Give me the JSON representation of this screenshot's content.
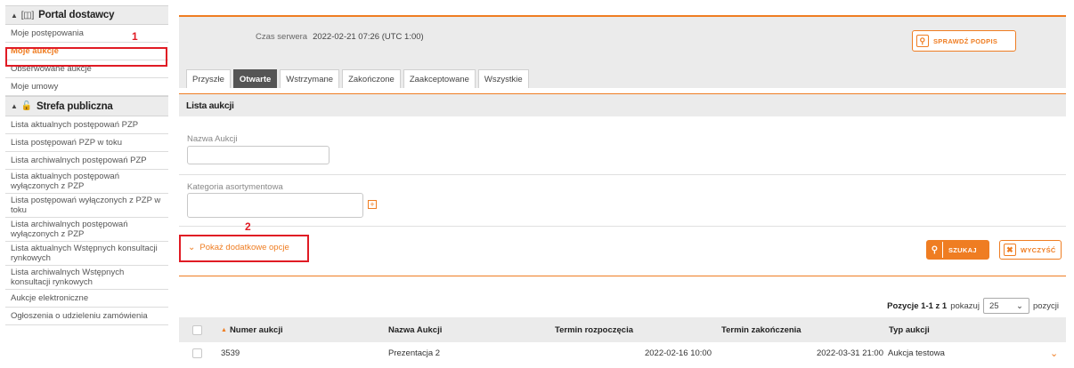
{
  "sidebar": {
    "portal_header": "Portal dostawcy",
    "portal_items": [
      "Moje postępowania",
      "Moje aukcje",
      "Obserwowane aukcje",
      "Moje umowy"
    ],
    "public_header": "Strefa publiczna",
    "public_items": [
      "Lista aktualnych postępowań PZP",
      "Lista postępowań PZP w toku",
      "Lista archiwalnych postępowań PZP",
      "Lista aktualnych postępowań wyłączonych z PZP",
      "Lista postępowań wyłączonych z PZP w toku",
      "Lista archiwalnych postępowań wyłączonych z PZP",
      "Lista aktualnych Wstępnych konsultacji rynkowych",
      "Lista archiwalnych Wstępnych konsultacji rynkowych",
      "Aukcje elektroniczne",
      "Ogłoszenia o udzieleniu zamówienia"
    ]
  },
  "annotations": {
    "one": "1",
    "two": "2"
  },
  "header": {
    "server_time_label": "Czas serwera",
    "server_time_value": "2022-02-21 07:26 (UTC 1:00)",
    "verify_button": "SPRAWDŹ PODPIS"
  },
  "tabs": [
    "Przyszłe",
    "Otwarte",
    "Wstrzymane",
    "Zakończone",
    "Zaakceptowane",
    "Wszystkie"
  ],
  "filters": {
    "section_title": "Lista aukcji",
    "name_label": "Nazwa Aukcji",
    "name_value": "",
    "category_label": "Kategoria asortymentowa",
    "category_value": "",
    "more_options": "Pokaż dodatkowe opcje",
    "search_button": "SZUKAJ",
    "clear_button": "WYCZYŚĆ"
  },
  "pagination": {
    "range_text": "Pozycje 1-1 z 1",
    "show_label": "pokazuj",
    "per_page": "25",
    "suffix": "pozycji"
  },
  "table": {
    "columns": [
      "Numer aukcji",
      "Nazwa Aukcji",
      "Termin rozpoczęcia",
      "Termin zakończenia",
      "Typ aukcji"
    ],
    "rows": [
      {
        "numer": "3539",
        "nazwa": "Prezentacja 2",
        "start": "2022-02-16 10:00",
        "end": "2022-03-31 21:00",
        "typ": "Aukcja testowa"
      }
    ]
  },
  "colors": {
    "accent": "#ef7d22",
    "annotation": "#e01b24"
  }
}
